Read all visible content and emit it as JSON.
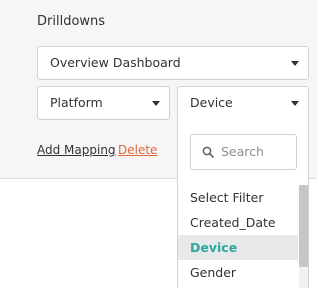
{
  "drilldowns": {
    "title": "Drilldowns",
    "dashboard_select": {
      "value": "Overview Dashboard"
    },
    "platform_select": {
      "value": "Platform"
    },
    "field_select": {
      "value": "Device",
      "search_placeholder": "Search",
      "options": [
        {
          "label": "Select Filter",
          "selected": false
        },
        {
          "label": "Created_Date",
          "selected": false
        },
        {
          "label": "Device",
          "selected": true
        },
        {
          "label": "Gender",
          "selected": false
        }
      ]
    },
    "actions": {
      "add_mapping": "Add Mapping",
      "delete": "Delete"
    }
  },
  "colors": {
    "accent": "#2ba79e",
    "danger": "#e2673b",
    "selected_bg": "#e6e8ea",
    "panel_bg": "#f6f6f6"
  },
  "icons": {
    "caret": "caret-down-icon",
    "search": "search-icon"
  }
}
